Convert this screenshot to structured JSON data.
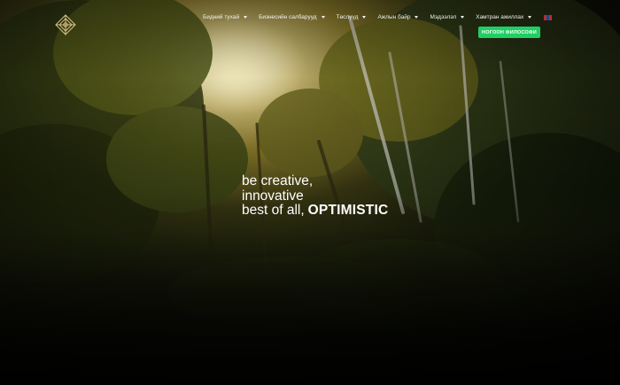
{
  "brand": {
    "name": "",
    "sub": "",
    "logo_icon": "diamond-ornament-logo"
  },
  "nav": {
    "items": [
      {
        "label": "Бидний тухай"
      },
      {
        "label": "Бизнесийн салбарууд"
      },
      {
        "label": "Төслүүд"
      },
      {
        "label": "Ажлын байр"
      },
      {
        "label": "Мэдээлэл"
      },
      {
        "label": "Хамтран ажиллах"
      }
    ],
    "language_flag": "mongolia-flag-icon"
  },
  "cta": {
    "label": "НОГООН ФИЛОСОФИ",
    "color": "#1fcf62"
  },
  "hero": {
    "line1": "be creative,",
    "line2": "innovative",
    "line3": "best of all,",
    "emphasis": "OPTIMISTIC"
  },
  "colors": {
    "flag_red": "#c4272f",
    "flag_blue": "#015197"
  }
}
